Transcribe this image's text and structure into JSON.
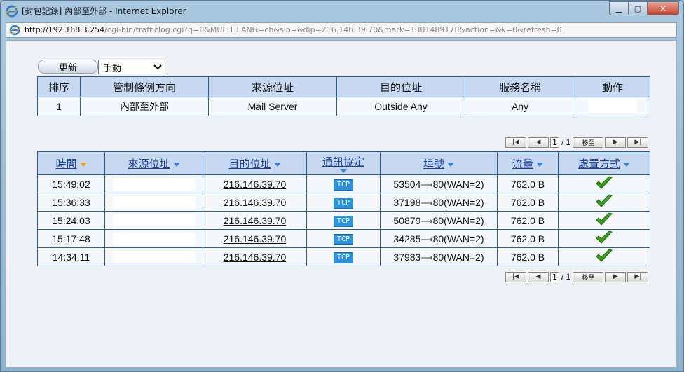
{
  "window": {
    "title": "[封包記錄] 內部至外部 - Internet Explorer",
    "address_host": "http://192.168.3.254",
    "address_path": "/cgi-bin/trafficlog.cgi?q=0&MULTI_LANG=ch&sip=&dip=216.146.39.70&mark=1301489178&action=&k=0&refresh=0"
  },
  "controls": {
    "refresh_label": "更新",
    "refresh_mode": "手動"
  },
  "rule_table": {
    "headers": [
      "排序",
      "管制條例方向",
      "來源位址",
      "目的位址",
      "服務名稱",
      "動作"
    ],
    "row": [
      "1",
      "內部至外部",
      "Mail Server",
      "Outside Any",
      "Any",
      ""
    ]
  },
  "pager": {
    "current_page": "1",
    "total": "/ 1",
    "go_label": "移至"
  },
  "log_table": {
    "headers": [
      "時間",
      "來源位址",
      "目的位址",
      "通訊協定",
      "埠號",
      "流量",
      "處置方式"
    ],
    "rows": [
      {
        "time": "15:49:02",
        "dst": "216.146.39.70",
        "proto": "TCP",
        "src_port": "53504",
        "dst_port": "80(WAN=2)",
        "traffic": "762.0 B"
      },
      {
        "time": "15:36:33",
        "dst": "216.146.39.70",
        "proto": "TCP",
        "src_port": "37198",
        "dst_port": "80(WAN=2)",
        "traffic": "762.0 B"
      },
      {
        "time": "15:24:03",
        "dst": "216.146.39.70",
        "proto": "TCP",
        "src_port": "50879",
        "dst_port": "80(WAN=2)",
        "traffic": "762.0 B"
      },
      {
        "time": "15:17:48",
        "dst": "216.146.39.70",
        "proto": "TCP",
        "src_port": "34285",
        "dst_port": "80(WAN=2)",
        "traffic": "762.0 B"
      },
      {
        "time": "14:34:11",
        "dst": "216.146.39.70",
        "proto": "TCP",
        "src_port": "37983",
        "dst_port": "80(WAN=2)",
        "traffic": "762.0 B"
      }
    ]
  },
  "icons": {
    "browser": "internet-explorer-icon",
    "action": "green-check-icon"
  },
  "colors": {
    "header_bg": "#c6d9f0",
    "border": "#2c5a96",
    "link": "#1a3f9c",
    "tcp_badge": "#2b93d9",
    "check": "#3aa21a"
  }
}
